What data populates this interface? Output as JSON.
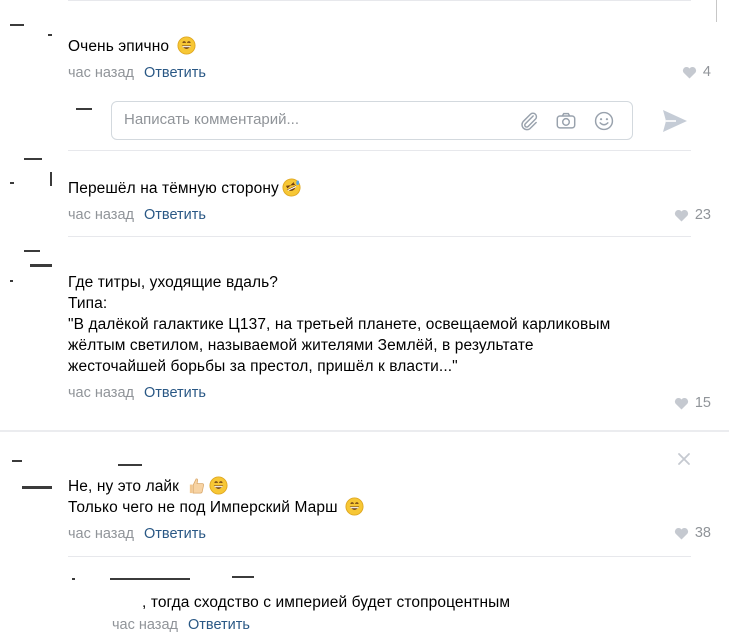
{
  "comments": [
    {
      "text": "Очень эпично",
      "time": "час назад",
      "reply_label": "Ответить",
      "likes": "4",
      "emoji": [
        "grin-emoji"
      ]
    },
    {
      "text": "Перешёл на тёмную сторону",
      "time": "час назад",
      "reply_label": "Ответить",
      "likes": "23",
      "emoji": [
        "rofl-emoji"
      ]
    },
    {
      "lines": [
        "Где титры, уходящие вдаль?",
        "Типа:",
        "\"В далёкой галактике Ц137, на третьей планете, освещаемой карликовым",
        "жёлтым светилом, называемой жителями Землёй, в результате",
        "жесточайшей борьбы за престол, пришёл к власти...\""
      ],
      "time": "час назад",
      "reply_label": "Ответить",
      "likes": "15"
    },
    {
      "lines": [
        "Не, ну это лайк",
        "Только чего не под Имперский Марш"
      ],
      "time": "час назад",
      "reply_label": "Ответить",
      "likes": "38",
      "emoji": [
        "thumbs-up-emoji",
        "grin-emoji",
        "grin-emoji"
      ]
    },
    {
      "text": ", тогда сходство с империей будет стопроцентным",
      "time": "час назад",
      "reply_label": "Ответить"
    }
  ],
  "reply_box": {
    "placeholder": "Написать комментарий..."
  },
  "icons": [
    "attach-icon",
    "camera-icon",
    "smile-icon",
    "send-icon",
    "heart-icon",
    "close-icon"
  ],
  "colors": {
    "link": "#2a5885",
    "meta": "#909499",
    "divider": "#e7e8ec",
    "heart": "#c5c9d0"
  }
}
